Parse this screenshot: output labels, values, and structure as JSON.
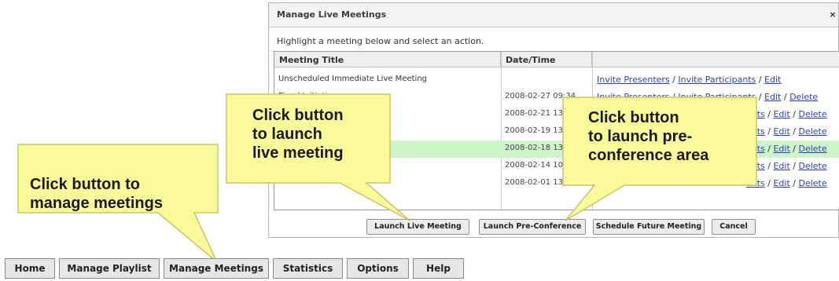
{
  "dialog": {
    "title": "Manage Live Meetings",
    "close_glyph": "×",
    "instruction": "Highlight a meeting below and select an action.",
    "columns": [
      "Meeting Title",
      "Date/Time",
      ""
    ],
    "rows": [
      {
        "title": "Unscheduled Immediate Live Meeting",
        "datetime": "",
        "invite_presenters": "Invite Presenters",
        "invite_participants": "Invite Participants",
        "edit": "Edit",
        "delete": ""
      },
      {
        "title": "Fiscal Initiatives",
        "datetime": "2008-02-27 09:34",
        "invite_presenters": "Invite Presenters",
        "invite_participants": "Invite Participants",
        "edit": "Edit",
        "delete": "Delete"
      },
      {
        "title": "",
        "datetime": "2008-02-21 13:24",
        "invite_presenters": "",
        "invite_participants": "ants",
        "edit": "Edit",
        "delete": "Delete"
      },
      {
        "title": "",
        "datetime": "2008-02-19 13:26",
        "invite_presenters": "",
        "invite_participants": "ants",
        "edit": "Edit",
        "delete": "Delete"
      },
      {
        "title": "",
        "datetime": "2008-02-18 13:18",
        "invite_presenters": "",
        "invite_participants": "ants",
        "edit": "Edit",
        "delete": "Delete"
      },
      {
        "title": "",
        "datetime": "2008-02-14 10:27",
        "invite_presenters": "",
        "invite_participants": "ants",
        "edit": "Edit",
        "delete": "Delete"
      },
      {
        "title": "",
        "datetime": "2008-02-01 13:00",
        "invite_presenters": "",
        "invite_participants": "ants",
        "edit": "Edit",
        "delete": "Delete"
      }
    ],
    "buttons": {
      "launch_live": "Launch Live Meeting",
      "launch_pre": "Launch Pre-Conference",
      "schedule": "Schedule Future Meeting",
      "cancel": "Cancel"
    }
  },
  "callouts": {
    "manage": [
      "Click button to",
      "manage meetings"
    ],
    "launch_live": [
      "Click button",
      "to launch",
      "live meeting"
    ],
    "launch_pre": [
      "Click button",
      "to launch pre-",
      "conference area"
    ]
  },
  "tabs": {
    "home": "Home",
    "playlist": "Manage Playlist",
    "meetings": "Manage Meetings",
    "statistics": "Statistics",
    "options": "Options",
    "help": "Help"
  },
  "colors": {
    "link": "#2a3fbf",
    "selected_row": "#cdf5c9",
    "callout_fill": "#fafa9b",
    "callout_border": "#c9c46b"
  }
}
